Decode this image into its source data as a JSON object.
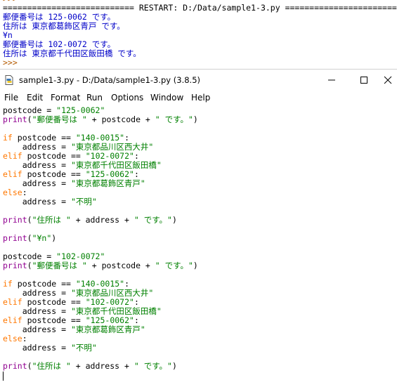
{
  "shell": {
    "top_partial": ">>>",
    "restart_line": "=========================== RESTART: D:/Data/sample1-3.py ==========================",
    "output": [
      "郵便番号は 125-0062 です。",
      "住所は 東京都葛飾区青戸 です。",
      "¥n",
      "郵便番号は 102-0072 です。",
      "住所は 東京都千代田区飯田橋 です。"
    ],
    "prompt": ">>>"
  },
  "window": {
    "title": "sample1-3.py - D:/Data/sample1-3.py (3.8.5)",
    "menu": [
      "File",
      "Edit",
      "Format",
      "Run",
      "Options",
      "Window",
      "Help"
    ]
  },
  "code": {
    "pc1_var": "postcode = ",
    "pc1_val": "\"125-0062\"",
    "pc2_var": "postcode = ",
    "pc2_val": "\"102-0072\"",
    "kw_print": "print",
    "kw_if": "if",
    "kw_elif": "elif",
    "kw_else": "else",
    "print_postal_open": "(",
    "str_postal": "\"郵便番号は \"",
    "plus_postcode_plus": " + postcode + ",
    "str_desu": "\" です。\"",
    "close_paren": ")",
    "cond_var": " postcode == ",
    "colon": ":",
    "code_140": "\"140-0015\"",
    "code_102": "\"102-0072\"",
    "code_125": "\"125-0062\"",
    "addr_assign": "    address = ",
    "addr_shinagawa": "\"東京都品川区西大井\"",
    "addr_chiyoda": "\"東京都千代田区飯田橋\"",
    "addr_katsushika": "\"東京都葛飾区青戸\"",
    "addr_unknown": "\"不明\"",
    "str_address": "\"住所は \"",
    "plus_address_plus": " + address + ",
    "str_yen_n": "\"¥n\""
  }
}
